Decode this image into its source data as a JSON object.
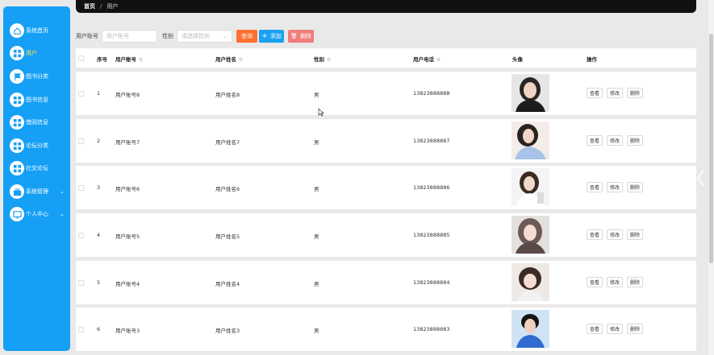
{
  "sidebar": {
    "items": [
      {
        "label": "系统首页",
        "icon": "home-icon"
      },
      {
        "label": "用户",
        "icon": "grid-icon"
      },
      {
        "label": "图书分类",
        "icon": "flag-icon"
      },
      {
        "label": "图书信息",
        "icon": "grid-icon"
      },
      {
        "label": "借阅信息",
        "icon": "grid-icon"
      },
      {
        "label": "论坛分类",
        "icon": "grid-icon"
      },
      {
        "label": "社交论坛",
        "icon": "grid-icon"
      },
      {
        "label": "系统管理",
        "icon": "briefcase-icon"
      },
      {
        "label": "个人中心",
        "icon": "monitor-icon"
      }
    ],
    "active_index": 1
  },
  "breadcrumb": {
    "home": "首页",
    "separator": "/",
    "current": "用户"
  },
  "search": {
    "account_label": "用户账号",
    "account_placeholder": "用户账号",
    "gender_label": "性别",
    "gender_placeholder": "请选择性别",
    "query_label": "查询",
    "add_label": "添加",
    "delete_label": "删除"
  },
  "table": {
    "headers": {
      "index": "序号",
      "account": "用户账号",
      "name": "用户姓名",
      "gender": "性别",
      "phone": "用户电话",
      "avatar": "头像",
      "actions": "操作"
    },
    "rows": [
      {
        "index": "1",
        "account": "用户账号8",
        "name": "用户姓名8",
        "gender": "男",
        "phone": "13823888888",
        "avatar": "portrait-dark-top"
      },
      {
        "index": "2",
        "account": "用户账号7",
        "name": "用户姓名7",
        "gender": "男",
        "phone": "13823888887",
        "avatar": "portrait-blue-top"
      },
      {
        "index": "3",
        "account": "用户账号6",
        "name": "用户姓名6",
        "gender": "男",
        "phone": "13823888886",
        "avatar": "portrait-white-top"
      },
      {
        "index": "4",
        "account": "用户账号5",
        "name": "用户姓名5",
        "gender": "男",
        "phone": "13823888885",
        "avatar": "portrait-light-hair"
      },
      {
        "index": "5",
        "account": "用户账号4",
        "name": "用户姓名4",
        "gender": "男",
        "phone": "13823888884",
        "avatar": "portrait-bob-hair"
      },
      {
        "index": "6",
        "account": "用户账号3",
        "name": "用户姓名3",
        "gender": "男",
        "phone": "13823888883",
        "avatar": "portrait-boy-blue"
      }
    ],
    "actions": {
      "view": "查看",
      "edit": "修改",
      "delete": "删除"
    }
  },
  "colors": {
    "sidebar": "#15a0f5",
    "active_nav": "#ffe14d",
    "query_button": "#ff6f2e",
    "add_button": "#1aa1f3",
    "delete_button": "#f17c7c"
  }
}
